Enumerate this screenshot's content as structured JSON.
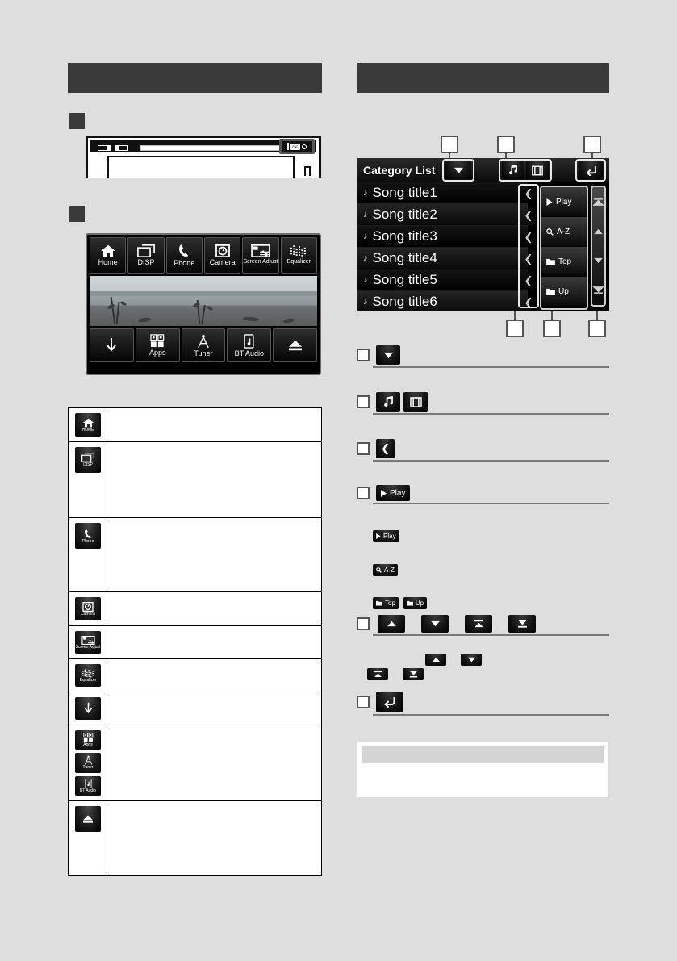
{
  "page": {
    "background_color": "#dedede",
    "header_color": "#3a3a3a"
  },
  "left_column": {
    "section_header": "",
    "section_markers": [
      "",
      ""
    ],
    "faceplate": {
      "name": "car-head-unit-faceplate",
      "highlight_key_label": "FNC"
    },
    "head_unit_screen": {
      "top_buttons": [
        {
          "icon": "home-icon",
          "label": "Home"
        },
        {
          "icon": "disp-icon",
          "label": "DISP"
        },
        {
          "icon": "phone-icon",
          "label": "Phone"
        },
        {
          "icon": "camera-icon",
          "label": "Camera"
        },
        {
          "icon": "screen-adjust-icon",
          "label": "Screen Adjust"
        },
        {
          "icon": "equalizer-icon",
          "label": "Equalizer"
        }
      ],
      "bottom_buttons": [
        {
          "icon": "arrow-down-icon",
          "label": ""
        },
        {
          "icon": "apps-icon",
          "label": "Apps"
        },
        {
          "icon": "tuner-icon",
          "label": "Tuner"
        },
        {
          "icon": "bt-audio-icon",
          "label": "BT Audio"
        },
        {
          "icon": "eject-icon",
          "label": ""
        }
      ]
    },
    "table": {
      "rows": [
        {
          "icons": [
            {
              "icon": "home-icon",
              "label": "HOME"
            }
          ],
          "description": ""
        },
        {
          "icons": [
            {
              "icon": "disp-icon",
              "label": "DISP"
            }
          ],
          "description": ""
        },
        {
          "icons": [
            {
              "icon": "phone-icon",
              "label": "Phone"
            }
          ],
          "description": ""
        },
        {
          "icons": [
            {
              "icon": "camera-icon",
              "label": "Camera"
            }
          ],
          "description": ""
        },
        {
          "icons": [
            {
              "icon": "screen-adjust-icon",
              "label": "Screen Adjust"
            }
          ],
          "description": ""
        },
        {
          "icons": [
            {
              "icon": "equalizer-icon",
              "label": "Equalizer"
            }
          ],
          "description": ""
        },
        {
          "icons": [
            {
              "icon": "arrow-down-icon",
              "label": ""
            }
          ],
          "description": ""
        },
        {
          "icons": [
            {
              "icon": "apps-icon",
              "label": "Apps"
            },
            {
              "icon": "tuner-icon",
              "label": "Tuner"
            },
            {
              "icon": "bt-audio-icon",
              "label": "BT Audio"
            }
          ],
          "description": ""
        },
        {
          "icons": [
            {
              "icon": "eject-icon",
              "label": ""
            }
          ],
          "description": ""
        }
      ]
    }
  },
  "right_column": {
    "section_header": "",
    "category_list": {
      "title": "Category List",
      "dropdown_icon": "triangle-down-icon",
      "media_tabs": [
        {
          "icon": "music-note-icon",
          "label": ""
        },
        {
          "icon": "film-strip-icon",
          "label": ""
        }
      ],
      "return_icon": "return-arrow-icon",
      "items": [
        {
          "icon": "music-note-icon",
          "label": "Song title1",
          "chevron": "chevron-left-icon"
        },
        {
          "icon": "music-note-icon",
          "label": "Song title2",
          "chevron": "chevron-left-icon"
        },
        {
          "icon": "music-note-icon",
          "label": "Song title3",
          "chevron": "chevron-left-icon"
        },
        {
          "icon": "music-note-icon",
          "label": "Song title4",
          "chevron": "chevron-left-icon"
        },
        {
          "icon": "music-note-icon",
          "label": "Song title5",
          "chevron": "chevron-left-icon"
        },
        {
          "icon": "music-note-icon",
          "label": "Song title6",
          "chevron": "chevron-left-icon"
        }
      ],
      "operation_buttons": [
        {
          "icon": "play-icon",
          "label": "Play"
        },
        {
          "icon": "search-icon",
          "label": "A-Z"
        },
        {
          "icon": "folder-icon",
          "label": "Top"
        },
        {
          "icon": "folder-icon",
          "label": "Up"
        }
      ],
      "scroll_buttons": [
        {
          "icon": "scroll-top-icon"
        },
        {
          "icon": "scroll-up-icon"
        },
        {
          "icon": "scroll-down-icon"
        },
        {
          "icon": "scroll-bottom-icon"
        }
      ]
    },
    "callouts": [
      "",
      "",
      "",
      "",
      "",
      ""
    ],
    "legend": [
      {
        "num": "",
        "chips": [
          {
            "icon": "triangle-down-icon",
            "label": ""
          }
        ],
        "description": ""
      },
      {
        "num": "",
        "chips": [
          {
            "icon": "music-note-icon",
            "label": ""
          },
          {
            "icon": "film-strip-icon",
            "label": ""
          }
        ],
        "description": ""
      },
      {
        "num": "",
        "chips": [
          {
            "icon": "chevron-left-icon",
            "label": ""
          }
        ],
        "description": ""
      },
      {
        "num": "",
        "chips": [
          {
            "icon": "play-icon",
            "label": "Play"
          }
        ],
        "description": ""
      },
      {
        "num": "",
        "chips": [
          {
            "icon": "scroll-up-icon",
            "label": ""
          },
          {
            "icon": "scroll-down-icon",
            "label": ""
          },
          {
            "icon": "scroll-top-icon",
            "label": ""
          },
          {
            "icon": "scroll-bottom-icon",
            "label": ""
          }
        ],
        "description": ""
      },
      {
        "num": "",
        "chips": [
          {
            "icon": "return-arrow-icon",
            "label": ""
          }
        ],
        "description": ""
      }
    ],
    "sub_items": [
      {
        "chips": [
          {
            "icon": "play-icon",
            "label": "Play"
          }
        ],
        "description": ""
      },
      {
        "chips": [
          {
            "icon": "search-icon",
            "label": "A-Z"
          }
        ],
        "description": ""
      },
      {
        "chips": [
          {
            "icon": "folder-icon",
            "label": "Top"
          },
          {
            "icon": "folder-icon",
            "label": "Up"
          }
        ],
        "description": ""
      },
      {
        "chips": [
          {
            "icon": "scroll-up-icon",
            "label": ""
          },
          {
            "icon": "scroll-down-icon",
            "label": ""
          }
        ],
        "description": ""
      },
      {
        "chips": [
          {
            "icon": "scroll-top-icon",
            "label": ""
          },
          {
            "icon": "scroll-bottom-icon",
            "label": ""
          }
        ],
        "description": ""
      }
    ],
    "note_box": {
      "header": "",
      "body": ""
    }
  }
}
